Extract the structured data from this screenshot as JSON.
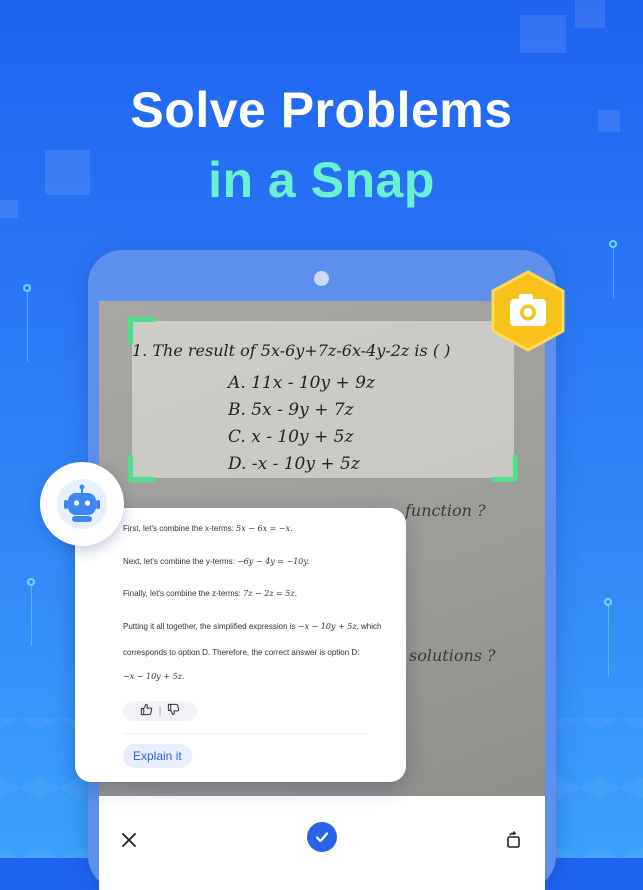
{
  "headline": {
    "line1": "Solve Problems",
    "line2": "in a Snap"
  },
  "colors": {
    "accent_green": "#6cf0d2",
    "primary_blue": "#2b63e8",
    "crop_corner": "#4ee08e",
    "camera_badge": "#f7c21b"
  },
  "scanned_question": {
    "stem": "1. The result of 5x-6y+7z-6x-4y-2z is ( )",
    "options": [
      "A. 11x - 10y + 9z",
      "B. 5x - 9y + 7z",
      "C. x - 10y + 5z",
      "D. -x - 10y + 5z"
    ],
    "partial_next_line": "function ?",
    "partial_lower_line": "solutions ?"
  },
  "answer": {
    "steps": [
      {
        "text": "First, let's combine the x-terms: ",
        "math": "5x − 6x = −x."
      },
      {
        "text": "Next, let's combine the y-terms: ",
        "math": "−6y − 4y = −10y."
      },
      {
        "text": "Finally, let's combine the z-terms: ",
        "math": "7z − 2z = 5z."
      },
      {
        "text": "Putting it all together, the simplified expression is ",
        "math": "−x − 10y + 5z",
        "suffix": ", which"
      },
      {
        "text": "corresponds to option D. Therefore, the correct answer is option D:"
      },
      {
        "text": "",
        "math": "−x − 10y + 5z."
      }
    ],
    "feedback_separator": "|",
    "explain_button": "Explain it"
  },
  "icons": {
    "camera": "camera-icon",
    "robot": "robot-icon",
    "thumbs_up": "thumbs-up-icon",
    "thumbs_down": "thumbs-down-icon",
    "close": "close-icon",
    "confirm": "check-icon",
    "rotate": "rotate-icon"
  }
}
